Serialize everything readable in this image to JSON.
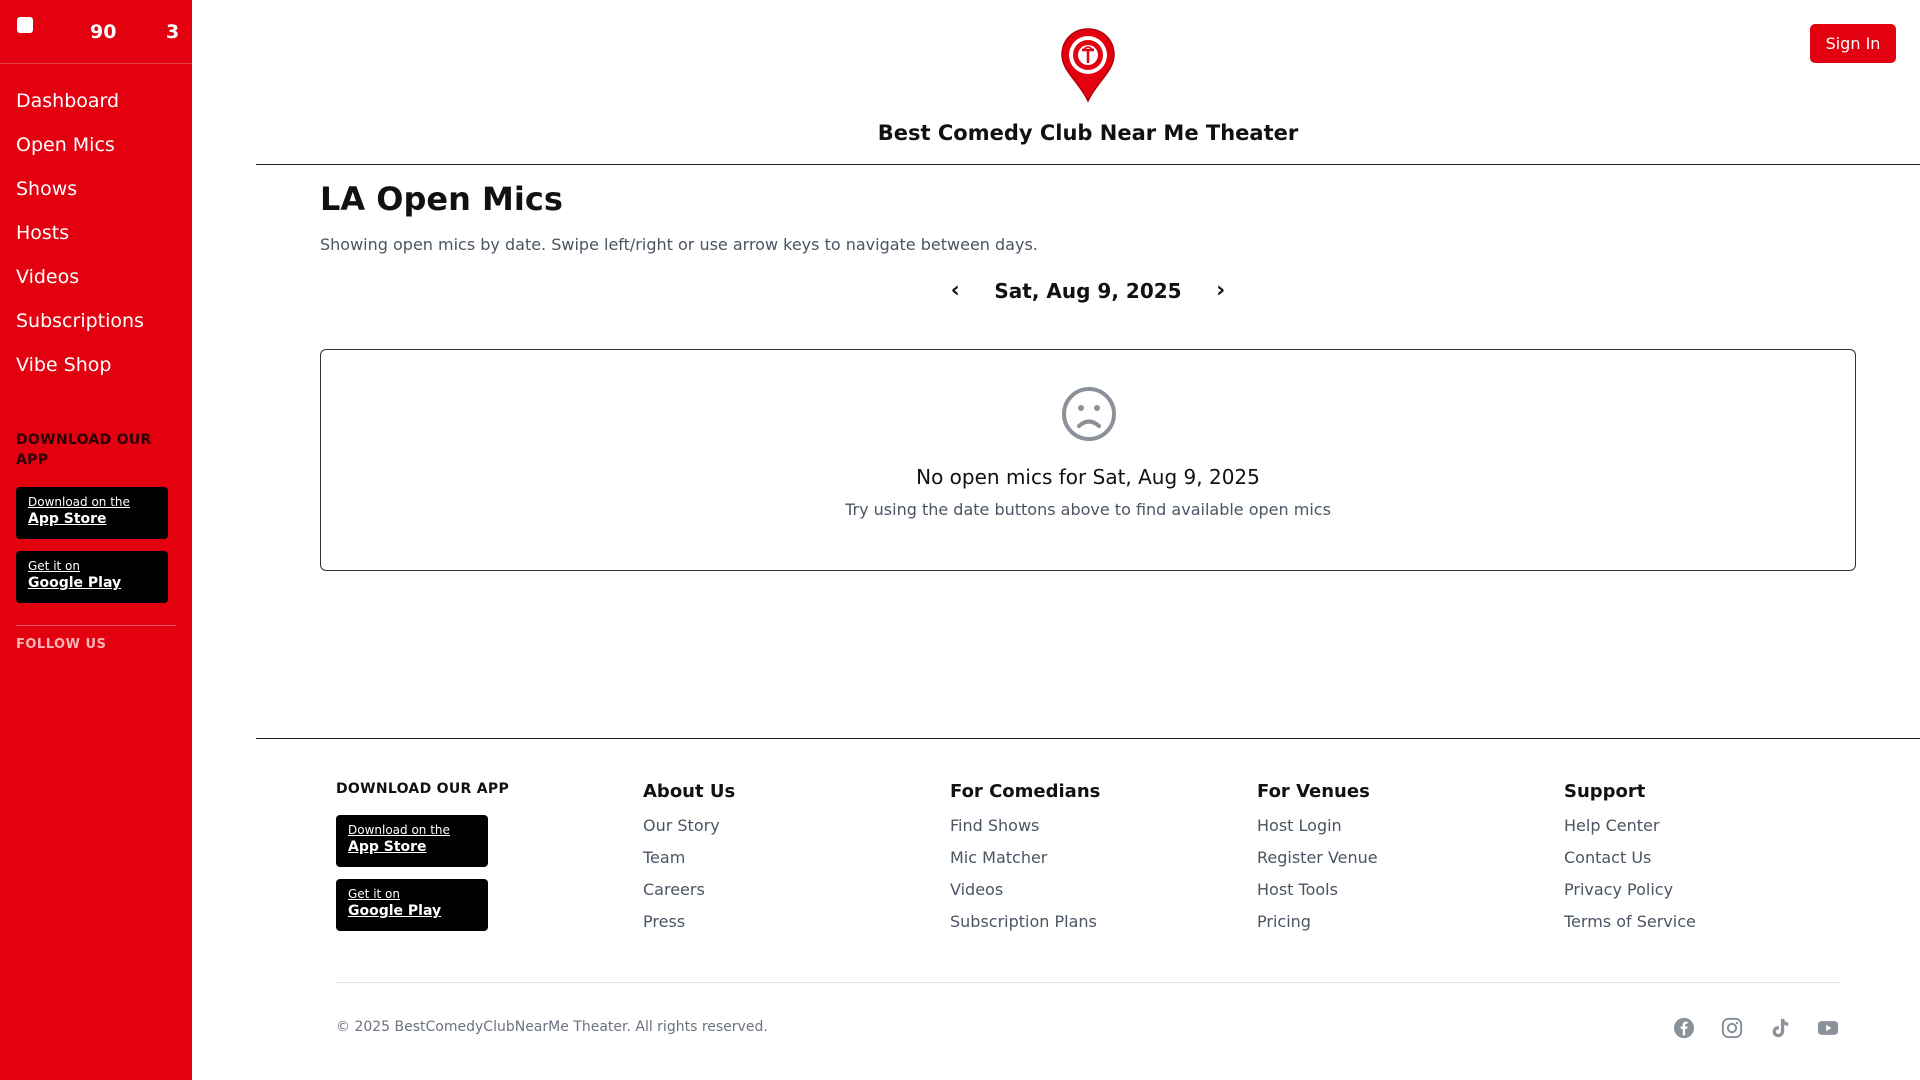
{
  "sidebar": {
    "count_left": "90",
    "count_right": "3",
    "nav": [
      {
        "label": "Dashboard"
      },
      {
        "label": "Open Mics"
      },
      {
        "label": "Shows"
      },
      {
        "label": "Hosts"
      },
      {
        "label": "Videos"
      },
      {
        "label": "Subscriptions"
      },
      {
        "label": "Vibe Shop"
      }
    ],
    "download_title": "DOWNLOAD OUR APP",
    "app_store": {
      "line1": "Download on the",
      "line2": "App Store"
    },
    "google_play": {
      "line1": "Get it on",
      "line2": "Google Play"
    },
    "follow_title": "FOLLOW US"
  },
  "header": {
    "logo_icon": "map-pin-logo-icon",
    "logo_text": "BEST COMEDY CLUB NEAR ME THEATER",
    "title": "Best Comedy Club Near Me Theater",
    "sign_in_label": "Sign In"
  },
  "main": {
    "title": "LA Open Mics",
    "description": "Showing open mics by date. Swipe left/right or use arrow keys to navigate between days.",
    "prev_arrow": "‹",
    "next_arrow": "›",
    "date": "Sat, Aug 9, 2025",
    "empty": {
      "icon": "sad-face-icon",
      "title": "No open mics for Sat, Aug 9, 2025",
      "subtitle": "Try using the date buttons above to find available open mics"
    }
  },
  "footer": {
    "download_title": "DOWNLOAD OUR APP",
    "app_store": {
      "line1": "Download on the",
      "line2": "App Store"
    },
    "google_play": {
      "line1": "Get it on",
      "line2": "Google Play"
    },
    "columns": [
      {
        "title": "About Us",
        "links": [
          "Our Story",
          "Team",
          "Careers",
          "Press"
        ]
      },
      {
        "title": "For Comedians",
        "links": [
          "Find Shows",
          "Mic Matcher",
          "Videos",
          "Subscription Plans"
        ]
      },
      {
        "title": "For Venues",
        "links": [
          "Host Login",
          "Register Venue",
          "Host Tools",
          "Pricing"
        ]
      },
      {
        "title": "Support",
        "links": [
          "Help Center",
          "Contact Us",
          "Privacy Policy",
          "Terms of Service"
        ]
      }
    ],
    "copyright": "© 2025 BestComedyClubNearMe Theater. All rights reserved.",
    "social_icons": [
      "facebook-icon",
      "instagram-icon",
      "tiktok-icon",
      "youtube-icon"
    ]
  },
  "colors": {
    "brand_red": "#e3000f",
    "muted_text": "#4a5563",
    "icon_gray": "#8b9199"
  }
}
